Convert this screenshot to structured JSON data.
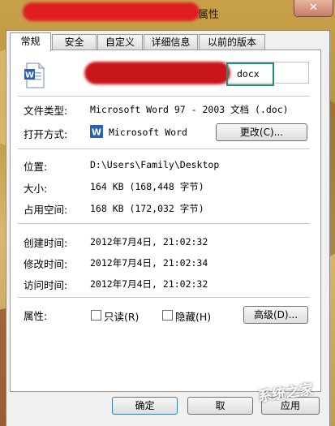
{
  "window": {
    "title": "属性",
    "close_glyph": "✕"
  },
  "tabs": [
    "常规",
    "安全",
    "自定义",
    "详细信息",
    "以前的版本"
  ],
  "file": {
    "name_ext": "docx"
  },
  "rows": {
    "type": {
      "label": "文件类型:",
      "value": "Microsoft Word 97 - 2003 文档 (.doc)"
    },
    "open_with": {
      "label": "打开方式:",
      "app": "Microsoft Word",
      "change_button": "更改(C)..."
    },
    "location": {
      "label": "位置:",
      "value": "D:\\Users\\Family\\Desktop"
    },
    "size": {
      "label": "大小:",
      "value": "164 KB (168,448 字节)"
    },
    "disk_size": {
      "label": "占用空间:",
      "value": "168 KB (172,032 字节)"
    },
    "created": {
      "label": "创建时间:",
      "value": "2012年7月4日, 21:02:32"
    },
    "modified": {
      "label": "修改时间:",
      "value": "2012年7月4日, 21:02:34"
    },
    "accessed": {
      "label": "访问时间:",
      "value": "2012年7月4日, 21:02:32"
    }
  },
  "attributes": {
    "label": "属性:",
    "readonly": "只读(R)",
    "hidden": "隐藏(H)",
    "advanced_button": "高级(D)..."
  },
  "buttons": {
    "ok": "确定",
    "cancel": "取",
    "apply": "应用"
  },
  "watermark": "系统之家"
}
